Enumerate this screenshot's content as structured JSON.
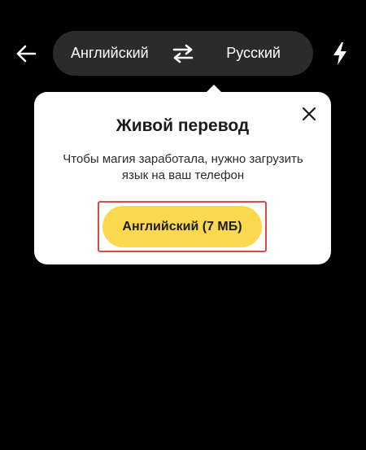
{
  "header": {
    "back_icon": "arrow-left-icon",
    "source_language": "Английский",
    "swap_icon": "swap-arrows-icon",
    "target_language": "Русский",
    "flash_icon": "lightning-icon"
  },
  "popup": {
    "title": "Живой перевод",
    "message": "Чтобы магия заработала, нужно загрузить язык на ваш телефон",
    "close_icon": "close-icon",
    "download_button_label": "Английский (7 МБ)"
  },
  "colors": {
    "background": "#000000",
    "pill": "#2b2b2b",
    "button_accent": "#fbd94f",
    "highlight_outline": "#d84a4a"
  }
}
